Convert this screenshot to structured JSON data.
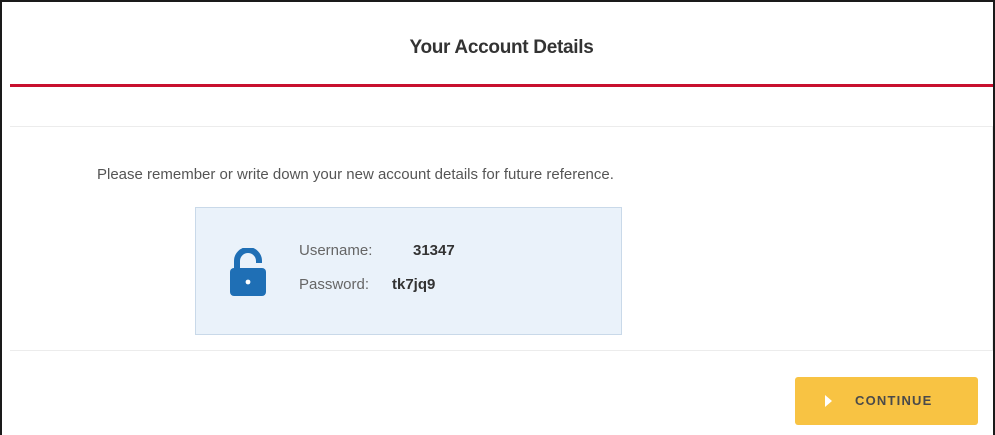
{
  "header": {
    "title": "Your Account Details"
  },
  "content": {
    "intro": "Please remember or write down your new account details for future reference.",
    "details": {
      "icon": "unlock-icon",
      "username_label": "Username:",
      "username_value": "31347",
      "password_label": "Password:",
      "password_value": "tk7jq9"
    }
  },
  "actions": {
    "continue_label": "CONTINUE",
    "continue_icon": "play-arrow-icon"
  },
  "colors": {
    "accent_red": "#c8102e",
    "icon_blue": "#1f6fb5",
    "button_yellow": "#f8c343",
    "panel_blue": "#eaf2fa"
  }
}
